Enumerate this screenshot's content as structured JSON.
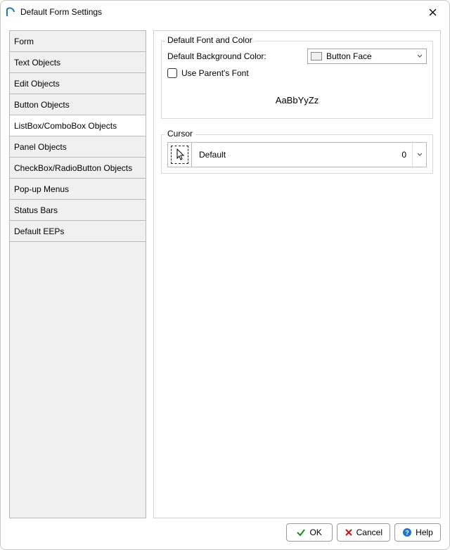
{
  "window": {
    "title": "Default Form Settings"
  },
  "sidenav": {
    "items": [
      {
        "label": "Form",
        "selected": false
      },
      {
        "label": "Text Objects",
        "selected": false
      },
      {
        "label": "Edit Objects",
        "selected": false
      },
      {
        "label": "Button Objects",
        "selected": false
      },
      {
        "label": "ListBox/ComboBox Objects",
        "selected": true
      },
      {
        "label": "Panel Objects",
        "selected": false
      },
      {
        "label": "CheckBox/RadioButton Objects",
        "selected": false
      },
      {
        "label": "Pop-up Menus",
        "selected": false
      },
      {
        "label": "Status Bars",
        "selected": false
      },
      {
        "label": "Default EEPs",
        "selected": false
      }
    ]
  },
  "font_color_group": {
    "legend": "Default Font and Color",
    "bg_label": "Default Background Color:",
    "bg_combo": {
      "text": "Button Face",
      "swatch_color": "#f0f0f0"
    },
    "use_parent_checkbox": {
      "label": "Use Parent's Font",
      "checked": false
    },
    "sample_text": "AaBbYyZz"
  },
  "cursor_group": {
    "legend": "Cursor",
    "name": "Default",
    "value": "0"
  },
  "buttons": {
    "ok": "OK",
    "cancel": "Cancel",
    "help": "Help"
  }
}
